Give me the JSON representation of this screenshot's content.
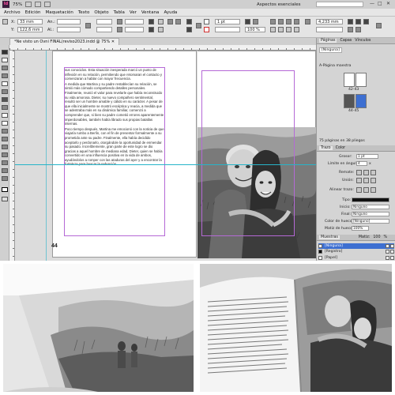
{
  "titlebar": {
    "app_logo": "Id",
    "zoom": "75%",
    "workspace": "Aspectos esenciales",
    "window_controls": [
      "—",
      "□",
      "✕"
    ]
  },
  "menu": [
    "Archivo",
    "Edición",
    "Maquetación",
    "Texto",
    "Objeto",
    "Tabla",
    "Ver",
    "Ventana",
    "Ayuda"
  ],
  "control": {
    "x_label": "X:",
    "x_value": "33 mm",
    "y_label": "Y:",
    "y_value": "122,6 mm",
    "w_label": "An.:",
    "h_label": "Al.:",
    "stroke_weight": "1 pt",
    "percent": "100 %",
    "dimension": "4,233 mm"
  },
  "document": {
    "tab_title": "*Ne visto un Ovni FINAL(reviso2023.indd @ 75%",
    "page_number": "44",
    "paragraphs": [
      "sus conocidos. Esta situación inesperada marcó un punto de inflexión en su relación, permitiendo que retomaran el contacto y comenzaran a hablar con mayor frecuencia.",
      "A medida que Martina y su padre restablecían su relación, se sintió más cómodo compartiendo detalles personales. Finalmente, reunió el valor para revelarle que había reconstruido su vida amorosa. Dieter, su nuevo compañero sentimental, resultó ser un hombre amable y cálido en su carácter. A pesar de que ella inicialmente se mostró escéptica y reacia, a medida que se adentraba más en su dinámica familiar, comenzó a comprender que, si bien su padre cometió errores aparentemente imperdonables, también había librado sus propias batallas internas.",
      "Poco tiempo después, Martina me emocionó con la noticia de que viajaría rumbo a Berlín, con el fin de presentar formalmente a su prometido ante su padre. Finalmente, ella había decidido aceptarlo y perdonarlo, otorgándole la oportunidad de enmendar su pasado. Increíblemente, gran parte de este logro se dio gracias a aquel hombre de mediana edad, Dieter, quien se había convertido en una influencia positiva en la vida de ambos, ayudándolos a romper con las ataduras del ayer y a encontrar la fortaleza para buscar la redención."
    ]
  },
  "pages_panel": {
    "tabs": [
      "Páginas",
      "Capas",
      "Vínculos"
    ],
    "active_tab": "Páginas",
    "none_master": "[Ninguna]",
    "master": "A-Página maestra",
    "spread_label_a": "42-43",
    "spread_label_b": "44-45",
    "footer": "75 páginas en 38 pliegos"
  },
  "stroke_panel": {
    "tabs": [
      "Trazo",
      "Color"
    ],
    "active_tab": "Trazo",
    "grosor_label": "Grosor:",
    "grosor_value": "1 pt",
    "limite_label": "Límite en ángulo:",
    "limite_value": "4",
    "limite_unit": "x",
    "remate_label": "Remate:",
    "union_label": "Unión:",
    "alinear_label": "Alinear trazo:",
    "tipo_label": "Tipo:",
    "inicio_label": "Inicio:",
    "inicio_value": "Ninguno",
    "final_label": "Final:",
    "final_value": "Ninguno",
    "color_hueco_label": "Color de hueco:",
    "color_hueco_value": "[Ninguno]",
    "matiz_hueco_label": "Matiz de hueco:",
    "matiz_hueco_value": "100%"
  },
  "swatches_panel": {
    "title": "Muestras",
    "tint_label": "Matiz:",
    "tint_value": "100",
    "tint_unit": "%",
    "rows": [
      {
        "name": "[Ninguna]",
        "color": "#ffffff"
      },
      {
        "name": "[Registro]",
        "color": "#000000"
      },
      {
        "name": "[Papel]",
        "color": "#ffffff"
      },
      {
        "name": "[Negro]",
        "color": "#000000"
      },
      {
        "name": "C=100 M=0 Y=0 K=0",
        "color": "#00a3e0"
      },
      {
        "name": "C=0 M=100 Y=0 K=0",
        "color": "#e4007c"
      }
    ],
    "selected_index": 0
  },
  "colors": {
    "accent_selection": "#3d6fd1",
    "margin_guide": "#b569d6",
    "ruler_guide": "#27b4c9",
    "indesign_pink": "#ff4f9e"
  }
}
